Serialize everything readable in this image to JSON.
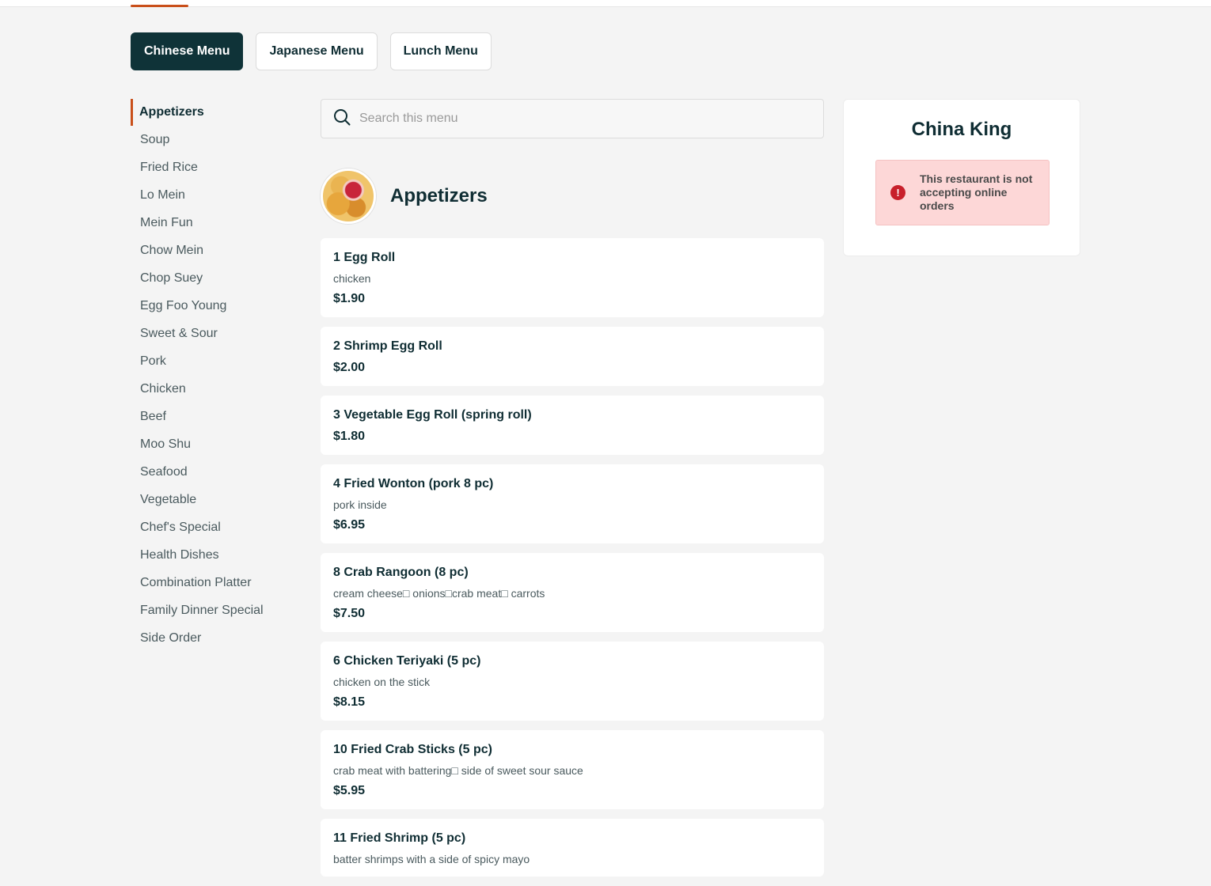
{
  "menus": [
    {
      "label": "Chinese Menu",
      "active": true
    },
    {
      "label": "Japanese Menu",
      "active": false
    },
    {
      "label": "Lunch Menu",
      "active": false
    }
  ],
  "categories": [
    "Appetizers",
    "Soup",
    "Fried Rice",
    "Lo Mein",
    "Mein Fun",
    "Chow Mein",
    "Chop Suey",
    "Egg Foo Young",
    "Sweet & Sour",
    "Pork",
    "Chicken",
    "Beef",
    "Moo Shu",
    "Seafood",
    "Vegetable",
    "Chef's Special",
    "Health Dishes",
    "Combination Platter",
    "Family Dinner Special",
    "Side Order"
  ],
  "active_category": "Appetizers",
  "search": {
    "placeholder": "Search this menu",
    "value": ""
  },
  "section": {
    "title": "Appetizers"
  },
  "items": [
    {
      "name": "1 Egg Roll",
      "description": "chicken",
      "price": "$1.90"
    },
    {
      "name": "2 Shrimp Egg Roll",
      "description": "",
      "price": "$2.00"
    },
    {
      "name": "3 Vegetable Egg Roll (spring roll)",
      "description": "",
      "price": "$1.80"
    },
    {
      "name": "4 Fried Wonton (pork 8 pc)",
      "description": "pork inside",
      "price": "$6.95"
    },
    {
      "name": "8 Crab Rangoon (8 pc)",
      "description": "cream cheese□ onions□crab meat□ carrots",
      "price": "$7.50"
    },
    {
      "name": "6 Chicken Teriyaki (5 pc)",
      "description": "chicken on the stick",
      "price": "$8.15"
    },
    {
      "name": "10 Fried Crab Sticks (5 pc)",
      "description": "crab meat with battering□ side of sweet sour sauce",
      "price": "$5.95"
    },
    {
      "name": "11 Fried Shrimp (5 pc)",
      "description": "batter shrimps with a side of spicy mayo",
      "price": ""
    }
  ],
  "restaurant": {
    "name": "China King",
    "alert_icon": "!",
    "alert": "This restaurant is not accepting online orders"
  },
  "colors": {
    "accent": "#c94f1a",
    "primary_dark": "#0f3338",
    "alert_bg": "#fdd7d7",
    "alert_icon": "#c8202b"
  }
}
